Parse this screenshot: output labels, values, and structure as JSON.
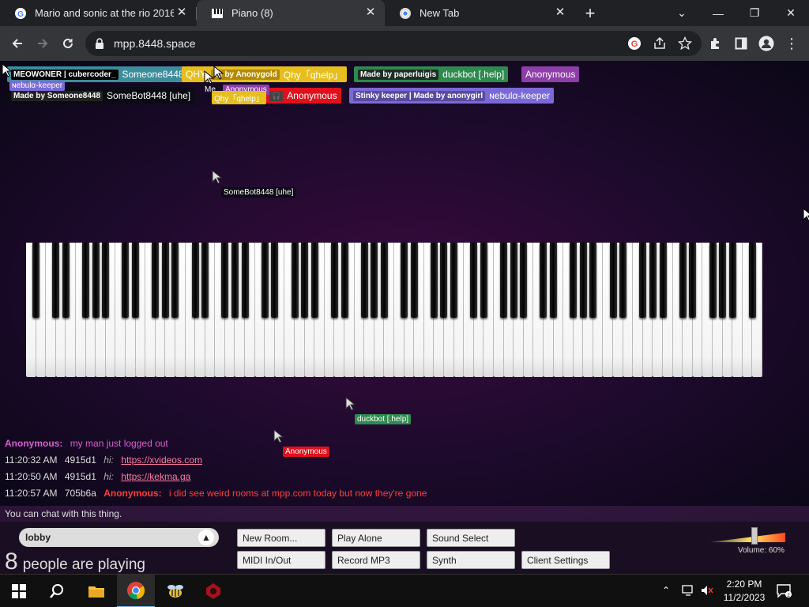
{
  "tabs": [
    {
      "title": "Mario and sonic at the rio 2016 ...",
      "icon": "google-icon"
    },
    {
      "title": "Piano (8)",
      "icon": "piano-icon"
    },
    {
      "title": "New Tab",
      "icon": "chrome-icon"
    }
  ],
  "address_bar": {
    "url": "mpp.8448.space"
  },
  "participants": {
    "row1": [
      {
        "tag": "MEOWONER | cubercoder_",
        "name": "Someone8448",
        "color": "#3d8d9c"
      },
      {
        "tag": "QHY",
        "name": "",
        "color": "#e6be1e"
      },
      {
        "tag": "de by Anonygold",
        "name": "Qhy「qhelp」",
        "color": "#e6be1e"
      },
      {
        "tag": "Made by paperluigis",
        "name": "duckbot [.help]",
        "color": "#2e8a4e"
      },
      {
        "tag": "",
        "name": "Anonymous",
        "color": "#8e3ea8"
      }
    ],
    "row2": [
      {
        "tag": "Made by Someone8448",
        "name": "SomeBot8448 [uhe]",
        "color": "#0b0b14"
      },
      {
        "tag": "",
        "name": "Anonymous",
        "color": "#e0101c"
      },
      {
        "tag": "Stinky keeper | Made by anonygirl",
        "name": "ɴebulα-keeper",
        "color": "#7a6ad8"
      }
    ],
    "overlaps": [
      "ɴebulα-keeper",
      "Anonymous",
      "Me",
      "Qhy「qhelp」"
    ]
  },
  "cursors": [
    {
      "name": "SomeBot8448 [uhe]",
      "color": "#111"
    },
    {
      "name": "duckbot [.help]",
      "color": "#2e8a4e"
    },
    {
      "name": "Anonymous",
      "color": "#e0101c"
    }
  ],
  "chat": {
    "messages": [
      {
        "time": "",
        "id": "",
        "user": "Anonymous:",
        "text": "my man just logged out",
        "user_color": "#d85fd0",
        "text_color": "#d85fd0"
      },
      {
        "time": "11:20:32 AM",
        "id": "4915d1",
        "user": "hi:",
        "text": "https://xvideos.com",
        "link": true
      },
      {
        "time": "11:20:50 AM",
        "id": "4915d1",
        "user": "hi:",
        "text": "https://kekma.ga",
        "link": true
      },
      {
        "time": "11:20:57 AM",
        "id": "705b6a",
        "user": "Anonymous:",
        "text": "i did see weird rooms at mpp.com today but now they're gone",
        "user_color": "#ff3e3e",
        "text_color": "#ff3e3e"
      }
    ],
    "placeholder": "You can chat with this thing."
  },
  "room": {
    "name": "lobby"
  },
  "people": {
    "count": "8",
    "label": "people are playing"
  },
  "buttons": {
    "new_room": "New Room...",
    "play_alone": "Play Alone",
    "sound_select": "Sound Select",
    "midi": "MIDI In/Out",
    "record": "Record MP3",
    "synth": "Synth",
    "client_settings": "Client Settings"
  },
  "volume": {
    "label": "Volume: 60%",
    "level": 0.6
  },
  "clock": {
    "time": "2:20 PM",
    "date": "11/2/2023"
  }
}
